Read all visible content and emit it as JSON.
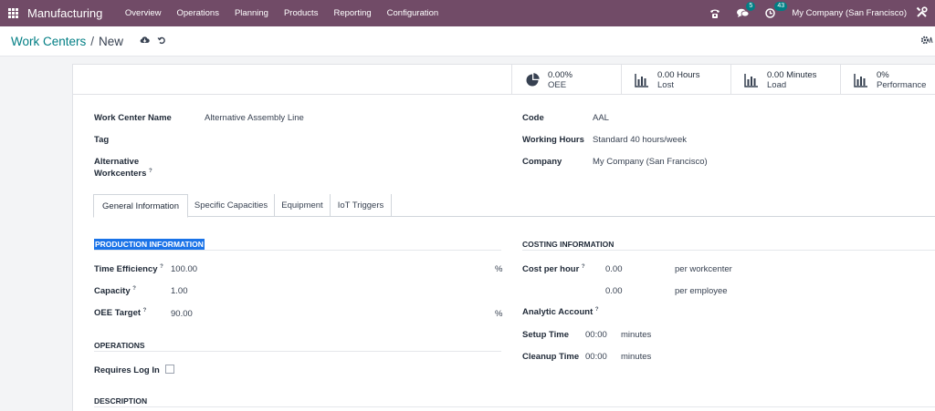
{
  "navbar": {
    "app_name": "Manufacturing",
    "menu": [
      "Overview",
      "Operations",
      "Planning",
      "Products",
      "Reporting",
      "Configuration"
    ],
    "chat_count": "5",
    "activity_count": "43",
    "company": "My Company (San Francisco)"
  },
  "breadcrumb": {
    "parent": "Work Centers",
    "separator": "/",
    "current": "New"
  },
  "stat_buttons": [
    {
      "value": "0.00%",
      "label": "OEE",
      "icon": "pie-chart-icon"
    },
    {
      "value": "0.00 Hours",
      "label": "Lost",
      "icon": "bar-chart-icon"
    },
    {
      "value": "0.00 Minutes",
      "label": "Load",
      "icon": "bar-chart-icon"
    },
    {
      "value": "0%",
      "label": "Performance",
      "icon": "bar-chart-icon"
    }
  ],
  "form": {
    "work_center_name_label": "Work Center Name",
    "work_center_name_value": "Alternative Assembly Line",
    "tag_label": "Tag",
    "alt_workcenters_label_1": "Alternative",
    "alt_workcenters_label_2": "Workcenters",
    "code_label": "Code",
    "code_value": "AAL",
    "working_hours_label": "Working Hours",
    "working_hours_value": "Standard 40 hours/week",
    "company_label": "Company",
    "company_value": "My Company (San Francisco)"
  },
  "tabs": [
    "General Information",
    "Specific Capacities",
    "Equipment",
    "IoT Triggers"
  ],
  "production": {
    "title": "PRODUCTION INFORMATION",
    "time_efficiency_label": "Time Efficiency",
    "time_efficiency_value": "100.00",
    "time_efficiency_unit": "%",
    "capacity_label": "Capacity",
    "capacity_value": "1.00",
    "oee_target_label": "OEE Target",
    "oee_target_value": "90.00",
    "oee_target_unit": "%"
  },
  "operations": {
    "title": "OPERATIONS",
    "requires_login_label": "Requires Log In"
  },
  "description": {
    "title": "DESCRIPTION"
  },
  "costing": {
    "title": "COSTING INFORMATION",
    "cost_per_hour_label": "Cost per hour",
    "cost_per_workcenter_value": "0.00",
    "per_workcenter": "per workcenter",
    "cost_per_employee_value": "0.00",
    "per_employee": "per employee",
    "analytic_account_label": "Analytic Account",
    "setup_time_label": "Setup Time",
    "setup_time_value": "00:00",
    "setup_time_unit": "minutes",
    "cleanup_time_label": "Cleanup Time",
    "cleanup_time_value": "00:00",
    "cleanup_time_unit": "minutes"
  },
  "help_mark": "?",
  "colors": {
    "navbar": "#714b67",
    "accent": "#017e84",
    "selection": "#1a73e8"
  }
}
